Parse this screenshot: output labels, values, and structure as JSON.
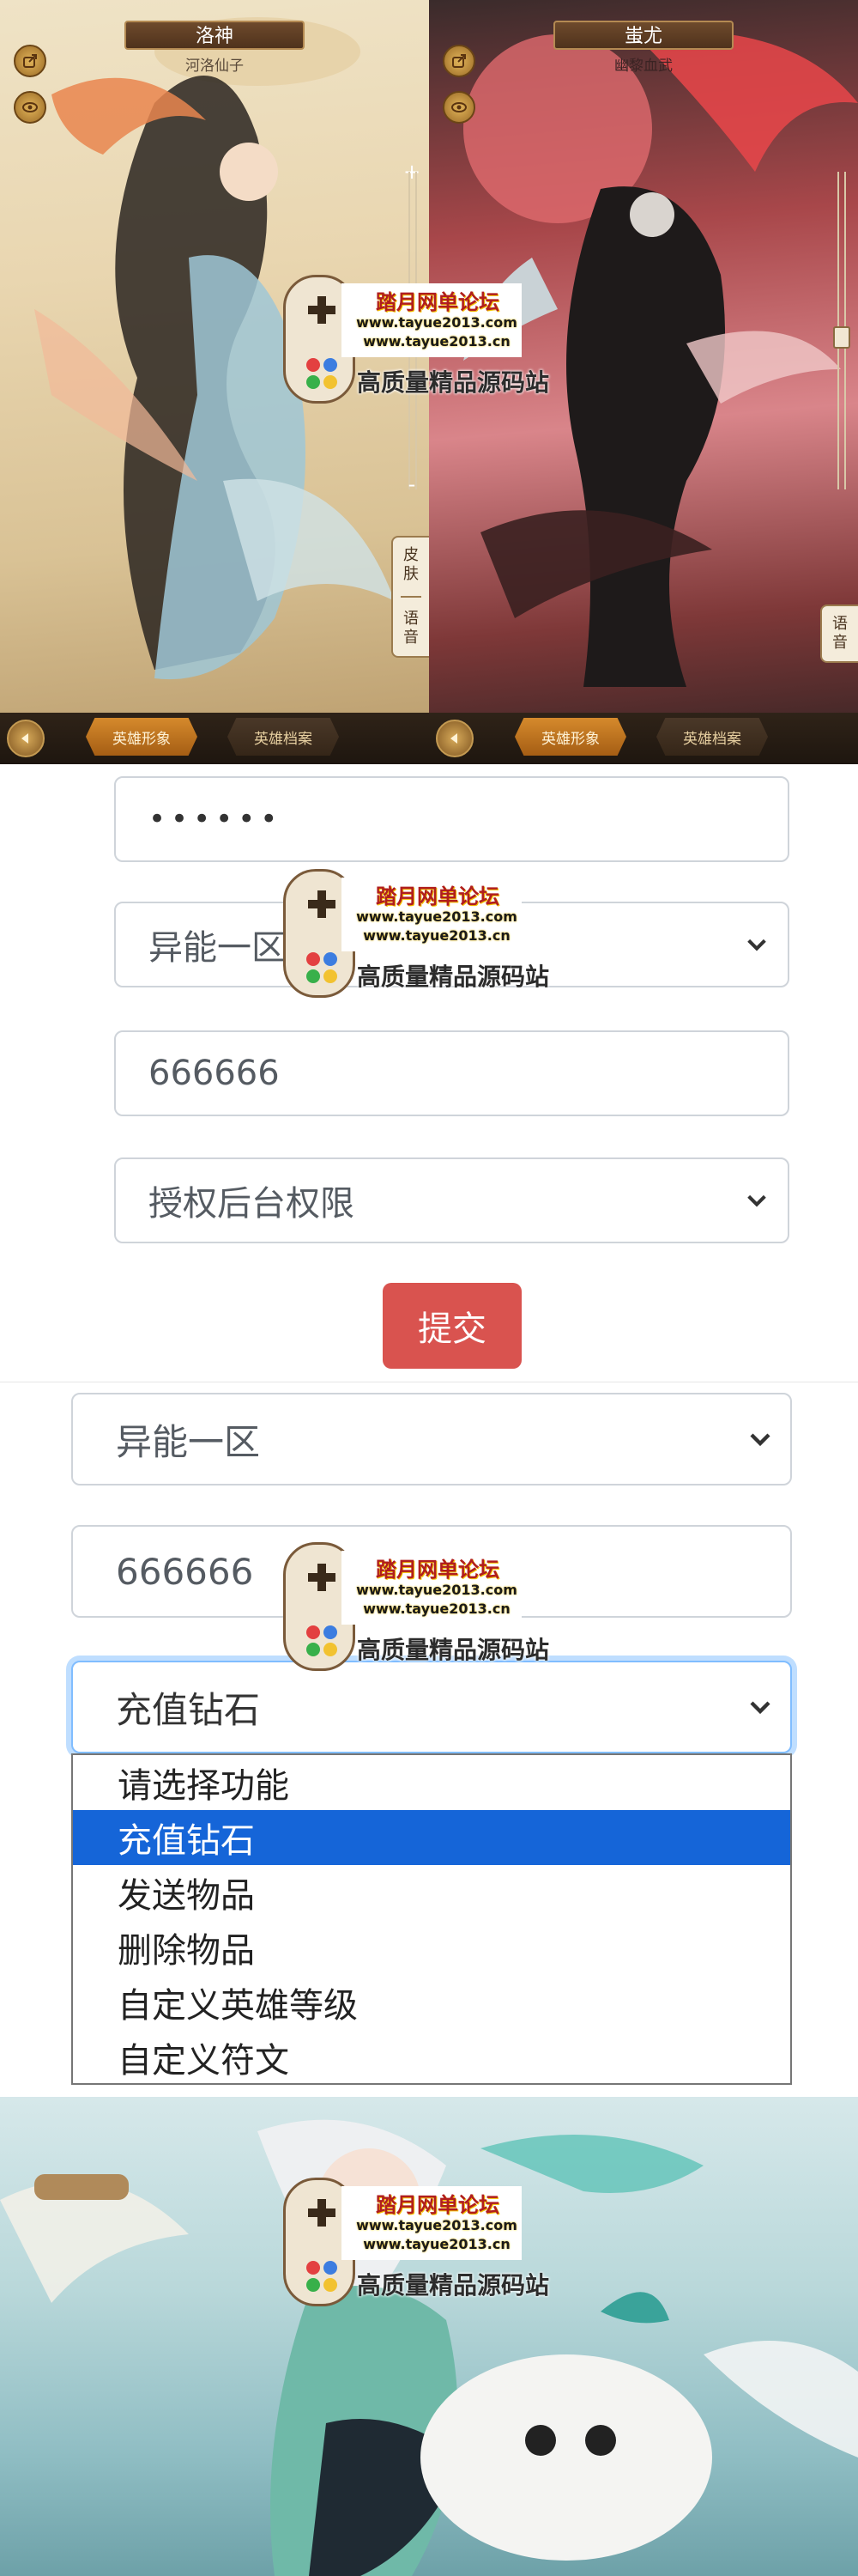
{
  "heroes": [
    {
      "name": "洛神",
      "subtitle": "河洛仙子",
      "side_tabs": [
        "皮肤",
        "语音"
      ]
    },
    {
      "name": "蚩尤",
      "subtitle": "幽黎血武",
      "side_tabs": [
        "语音"
      ]
    }
  ],
  "hero_bottom_tabs": {
    "active": "英雄形象",
    "inactive": "英雄档案"
  },
  "zoom": {
    "plus": "+",
    "minus": "-"
  },
  "login_form": {
    "password_value": "••••••",
    "zone_select": "异能一区",
    "account_value": "666666",
    "permission_select": "授权后台权限",
    "submit_label": "提交"
  },
  "function_form": {
    "zone_select": "异能一区",
    "account_value": "666666",
    "function_select": "充值钻石",
    "options": [
      "请选择功能",
      "充值钻石",
      "发送物品",
      "删除物品",
      "自定义英雄等级",
      "自定义符文"
    ],
    "selected_index": 1
  },
  "watermark": {
    "title": "踏月网单论坛",
    "url1": "www.tayue2013.com",
    "url2": "www.tayue2013.cn",
    "slogan": "高质量精品源码站"
  },
  "colors": {
    "submit": "#d9534f",
    "option_highlight": "#1565d8",
    "tab_active": "#d58a2c"
  },
  "icons": [
    "share-icon",
    "eye-icon",
    "back-arrow-icon",
    "chevron-down-icon",
    "gamepad-icon"
  ]
}
